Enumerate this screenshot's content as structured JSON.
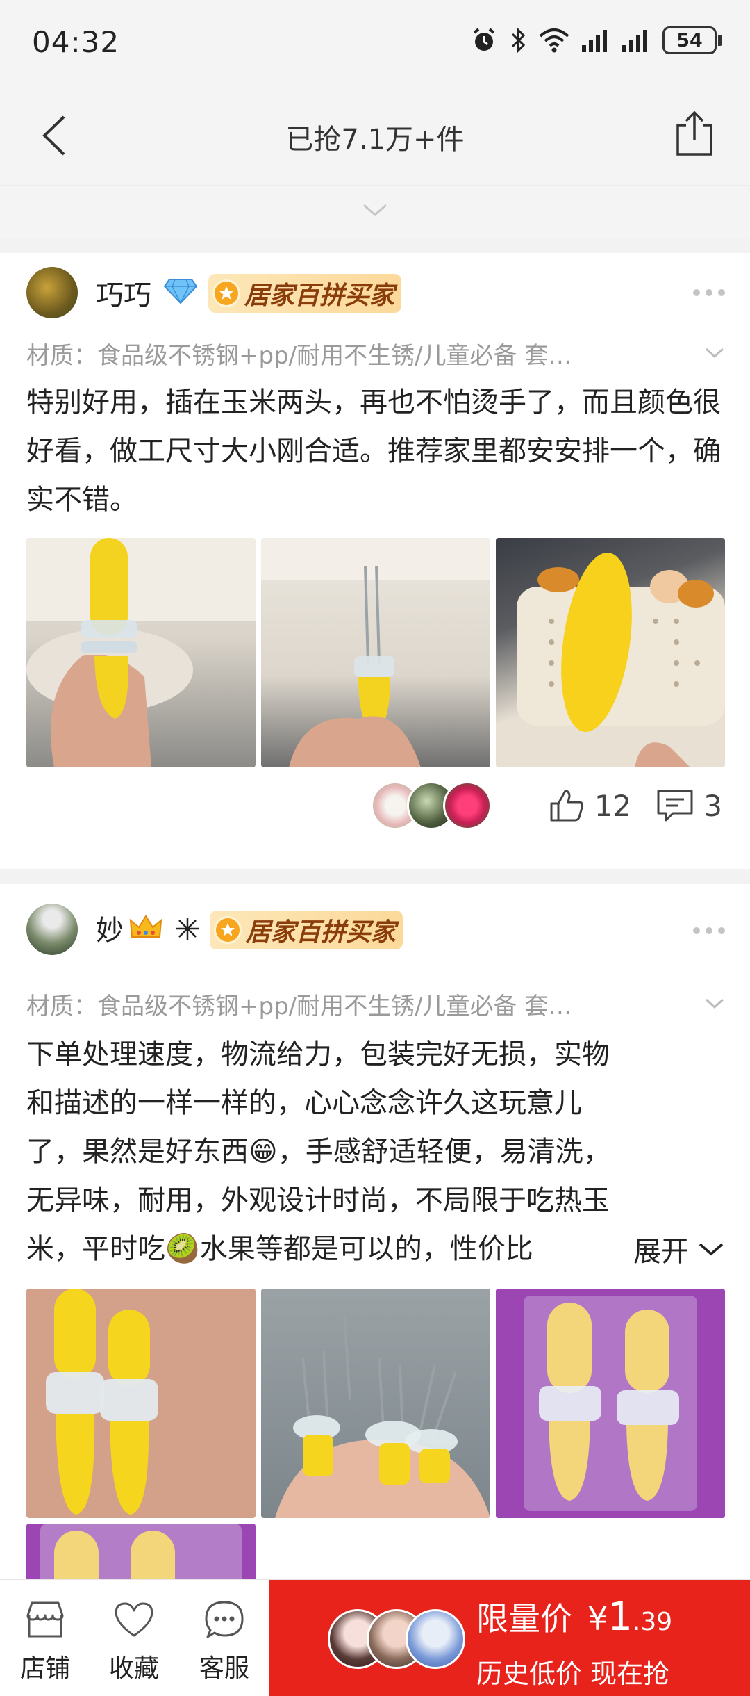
{
  "status_bar": {
    "time": "04:32",
    "battery": "54"
  },
  "header": {
    "title": "已抢7.1万+件"
  },
  "reviews": [
    {
      "username": "巧巧",
      "tag": "居家百拼买家",
      "sku": "材质：食品级不锈钢+pp/耐用不生锈/儿童必备   套…",
      "text": "特别好用，插在玉米两头，再也不怕烫手了，而且颜色很好看，做工尺寸大小刚合适。推荐家里都安安排一个，确实不错。",
      "likes": "12",
      "comments": "3"
    },
    {
      "username": "妙",
      "tag": "居家百拼买家",
      "sku": "材质：食品级不锈钢+pp/耐用不生锈/儿童必备   套…",
      "text_lines": [
        "下单处理速度，物流给力，包装完好无损，实物",
        "和描述的一样一样的，心心念念许久这玩意儿",
        "了，果然是好东西😁，手感舒适轻便，易清洗，",
        "无异味，耐用，外观设计时尚，不局限于吃热玉",
        "米，平时吃🥝水果等都是可以的，性价比"
      ],
      "expand_label": "展开"
    }
  ],
  "bottom_bar": {
    "shop": "店铺",
    "favorite": "收藏",
    "service": "客服",
    "price_label": "限量价",
    "price_currency": "¥",
    "price_int": "1",
    "price_dec": ".39",
    "price_sub": "历史低价 现在抢"
  },
  "colors": {
    "accent": "#e8231c",
    "tag_bg": "#fbd99a",
    "tag_text": "#8a3c0b"
  }
}
